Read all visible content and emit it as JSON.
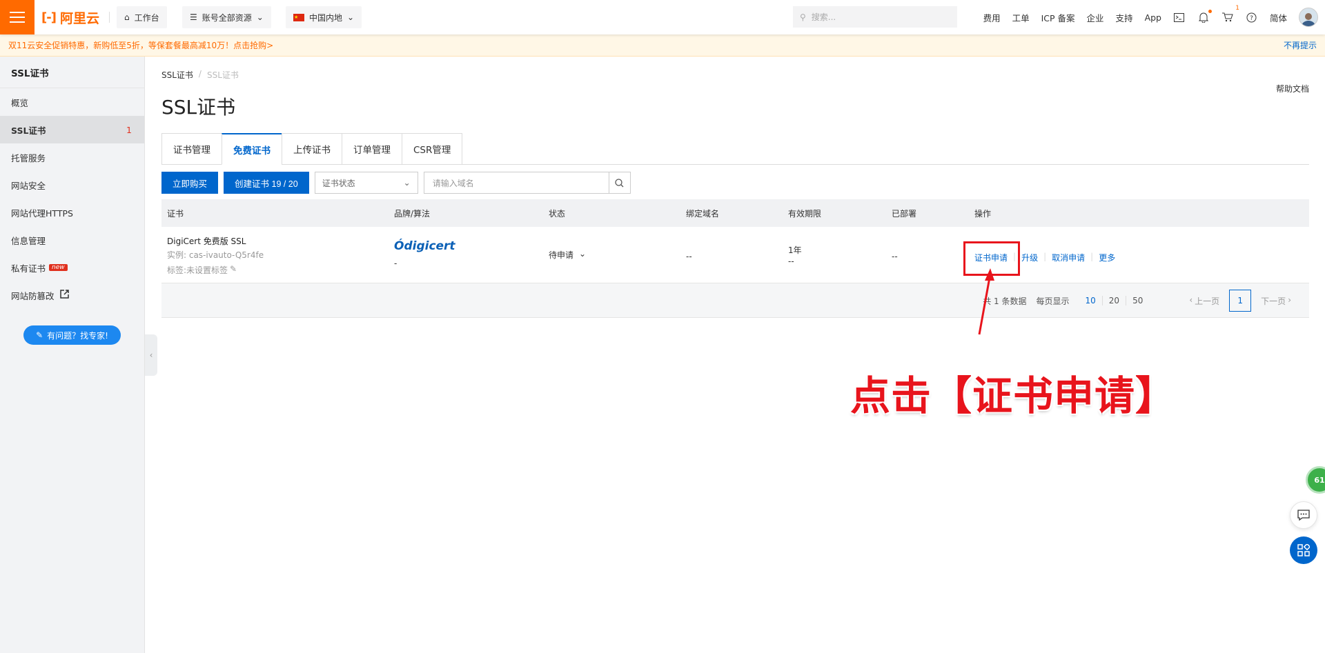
{
  "topbar": {
    "logo_text": "阿里云",
    "workbench": "工作台",
    "resources": "账号全部资源",
    "region": "中国内地",
    "search_placeholder": "搜索...",
    "links": [
      "费用",
      "工单",
      "ICP 备案",
      "企业",
      "支持",
      "App"
    ],
    "cart_badge": "1",
    "lang": "简体"
  },
  "promo": {
    "text": "双11云安全促销特惠，新购低至5折，等保套餐最高减10万！点击抢购>",
    "dismiss": "不再提示"
  },
  "sidebar": {
    "title": "SSL证书",
    "items": [
      {
        "label": "概览"
      },
      {
        "label": "SSL证书",
        "count": "1"
      },
      {
        "label": "托管服务"
      },
      {
        "label": "网站安全"
      },
      {
        "label": "网站代理HTTPS"
      },
      {
        "label": "信息管理"
      },
      {
        "label": "私有证书",
        "tag": "new"
      },
      {
        "label": "网站防篡改"
      }
    ],
    "ask_button": "有问题？找专家!"
  },
  "main": {
    "breadcrumb": [
      "SSL证书",
      "/",
      "SSL证书"
    ],
    "help": "帮助文档",
    "title": "SSL证书",
    "tabs": [
      "证书管理",
      "免费证书",
      "上传证书",
      "订单管理",
      "CSR管理"
    ],
    "buy_button": "立即购买",
    "create_button": "创建证书 19 / 20",
    "status_select": "证书状态",
    "domain_placeholder": "请输入域名"
  },
  "table": {
    "headers": [
      "证书",
      "品牌/算法",
      "状态",
      "绑定域名",
      "有效期限",
      "已部署",
      "操作"
    ],
    "row": {
      "name": "DigiCert 免费版 SSL",
      "instance": "实例: cas-ivauto-Q5r4fe",
      "tag": "标签:未设置标签",
      "brand": "digicert",
      "algo": "-",
      "status": "待申请",
      "domain": "--",
      "validity": "1年",
      "validity_sub": "--",
      "deployed": "--",
      "actions": [
        "证书申请",
        "升级",
        "取消申请",
        "更多"
      ]
    },
    "footer": {
      "total": "共 1 条数据",
      "per_page_label": "每页显示",
      "sizes": [
        "10",
        "20",
        "50"
      ],
      "prev": "上一页",
      "page": "1",
      "next": "下一页"
    }
  },
  "annotation": "点击【证书申请】",
  "float": {
    "score": "61"
  },
  "colors": {
    "brand": "#ff6a00",
    "primary": "#0066cc",
    "annotation": "#e8141c"
  }
}
